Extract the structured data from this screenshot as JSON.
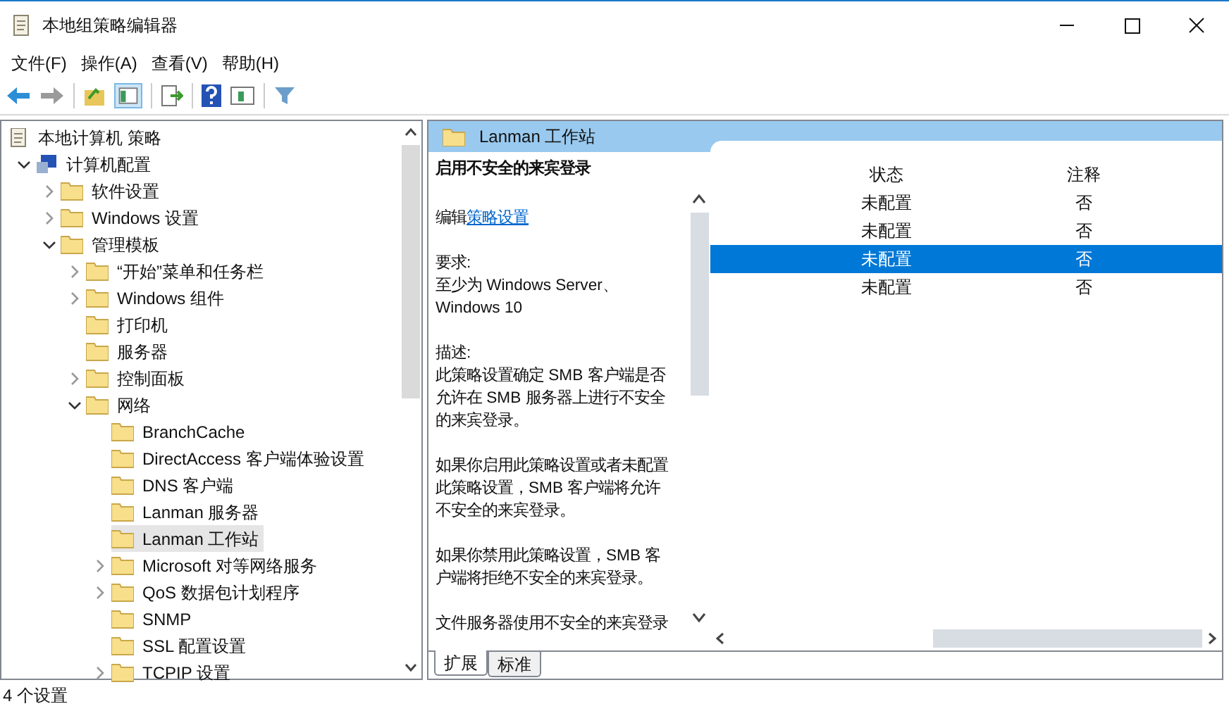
{
  "window": {
    "title": "本地组策略编辑器"
  },
  "menu": [
    "文件(F)",
    "操作(A)",
    "查看(V)",
    "帮助(H)"
  ],
  "tree": [
    {
      "label": "本地计算机 策略",
      "kind": "root",
      "selected": false,
      "children": [
        {
          "label": "计算机配置",
          "kind": "computer",
          "expanded": true,
          "selected": false,
          "children": [
            {
              "label": "软件设置",
              "kind": "folder",
              "expanded": false,
              "selected": false
            },
            {
              "label": "Windows 设置",
              "kind": "folder",
              "expanded": false,
              "selected": false
            },
            {
              "label": "管理模板",
              "kind": "folder",
              "expanded": true,
              "selected": false,
              "children": [
                {
                  "label": "“开始”菜单和任务栏",
                  "kind": "folder",
                  "expanded": false,
                  "selected": false
                },
                {
                  "label": "Windows 组件",
                  "kind": "folder",
                  "expanded": false,
                  "selected": false
                },
                {
                  "label": "打印机",
                  "kind": "folder",
                  "selected": false
                },
                {
                  "label": "服务器",
                  "kind": "folder",
                  "selected": false
                },
                {
                  "label": "控制面板",
                  "kind": "folder",
                  "expanded": false,
                  "selected": false
                },
                {
                  "label": "网络",
                  "kind": "folder",
                  "expanded": true,
                  "selected": false,
                  "children": [
                    {
                      "label": "BranchCache",
                      "kind": "folder",
                      "selected": false
                    },
                    {
                      "label": "DirectAccess 客户端体验设置",
                      "kind": "folder",
                      "selected": false
                    },
                    {
                      "label": "DNS 客户端",
                      "kind": "folder",
                      "selected": false
                    },
                    {
                      "label": "Lanman 服务器",
                      "kind": "folder",
                      "selected": false
                    },
                    {
                      "label": "Lanman 工作站",
                      "kind": "folder",
                      "selected": true
                    },
                    {
                      "label": "Microsoft 对等网络服务",
                      "kind": "folder",
                      "expanded": false,
                      "selected": false
                    },
                    {
                      "label": "QoS 数据包计划程序",
                      "kind": "folder",
                      "expanded": false,
                      "selected": false
                    },
                    {
                      "label": "SNMP",
                      "kind": "folder",
                      "selected": false
                    },
                    {
                      "label": "SSL 配置设置",
                      "kind": "folder",
                      "selected": false
                    },
                    {
                      "label": "TCPIP 设置",
                      "kind": "folder",
                      "expanded": false,
                      "selected": false
                    }
                  ]
                }
              ]
            }
          ]
        }
      ]
    }
  ],
  "details": {
    "header": "Lanman 工作站",
    "setting_title": "启用不安全的来宾登录",
    "edit_prefix": "编辑",
    "edit_link": "策略设置",
    "paragraphs": [
      [
        "要求:",
        "至少为 Windows Server、",
        "Windows 10"
      ],
      [
        "描述:",
        "此策略设置确定 SMB 客户端是否",
        "允许在 SMB 服务器上进行不安全",
        "的来宾登录。"
      ],
      [
        "如果你启用此策略设置或者未配置",
        "此策略设置，SMB 客户端将允许",
        "不安全的来宾登录。"
      ],
      [
        "如果你禁用此策略设置，SMB 客",
        "户端将拒绝不安全的来宾登录。"
      ],
      [
        "文件服务器使用不安全的来宾登录"
      ]
    ]
  },
  "table": {
    "columns": [
      "状态",
      "注释"
    ],
    "rows": [
      {
        "cells": [
          "未配置",
          "否"
        ],
        "selected": false
      },
      {
        "cells": [
          "未配置",
          "否"
        ],
        "selected": false
      },
      {
        "cells": [
          "未配置",
          "否"
        ],
        "selected": true
      },
      {
        "cells": [
          "未配置",
          "否"
        ],
        "selected": false
      }
    ]
  },
  "view_tabs": [
    {
      "label": "扩展",
      "selected": true
    },
    {
      "label": "标准",
      "selected": false
    }
  ],
  "status_bar": "4 个设置"
}
